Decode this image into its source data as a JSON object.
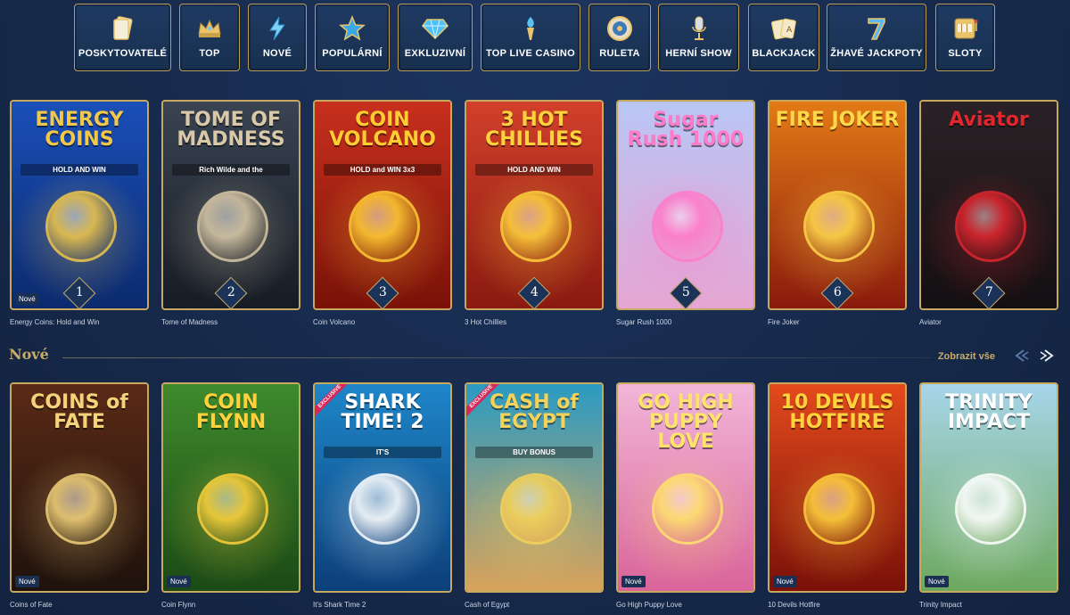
{
  "categories": [
    {
      "label": "POSKYTOVATELÉ",
      "icon": "cards-icon"
    },
    {
      "label": "TOP",
      "icon": "crown-icon"
    },
    {
      "label": "NOVÉ",
      "icon": "lightning-icon"
    },
    {
      "label": "POPULÁRNÍ",
      "icon": "star-icon"
    },
    {
      "label": "EXKLUZIVNÍ",
      "icon": "diamond-icon"
    },
    {
      "label": "TOP LIVE CASINO",
      "icon": "torch-icon"
    },
    {
      "label": "RULETA",
      "icon": "roulette-icon"
    },
    {
      "label": "HERNÍ SHOW",
      "icon": "microphone-icon"
    },
    {
      "label": "BLACKJACK",
      "icon": "playing-cards-icon"
    },
    {
      "label": "ŽHAVÉ JACKPOTY",
      "icon": "seven-icon"
    },
    {
      "label": "SLOTY",
      "icon": "slot-machine-icon"
    }
  ],
  "top_games": [
    {
      "name": "Energy Coins: Hold and Win",
      "art_title": "ENERGY COINS",
      "art_sub": "HOLD AND WIN",
      "rank": "1",
      "badge": "Nové",
      "bg1": "#1a4fb8",
      "bg2": "#0b2a6e",
      "accent": "#f2c84b"
    },
    {
      "name": "Tome of Madness",
      "art_title": "TOME OF MADNESS",
      "art_sub": "Rich Wilde and the",
      "rank": "2",
      "badge": "",
      "bg1": "#3a4452",
      "bg2": "#161c25",
      "accent": "#d9c9a8"
    },
    {
      "name": "Coin Volcano",
      "art_title": "COIN VOLCANO",
      "art_sub": "HOLD and WIN 3x3",
      "rank": "3",
      "badge": "",
      "bg1": "#c8301d",
      "bg2": "#7a1208",
      "accent": "#ffcc33"
    },
    {
      "name": "3 Hot Chillies",
      "art_title": "3 HOT CHILLIES",
      "art_sub": "HOLD AND WIN",
      "rank": "4",
      "badge": "",
      "bg1": "#d1402a",
      "bg2": "#8a1a10",
      "accent": "#ffd23d"
    },
    {
      "name": "Sugar Rush 1000",
      "art_title": "Sugar Rush 1000",
      "art_sub": "",
      "rank": "5",
      "badge": "",
      "bg1": "#b9c6f5",
      "bg2": "#e6a6d4",
      "accent": "#ff7ac8"
    },
    {
      "name": "Fire Joker",
      "art_title": "FIRE JOKER",
      "art_sub": "",
      "rank": "6",
      "badge": "",
      "bg1": "#e37a16",
      "bg2": "#8a1a0c",
      "accent": "#ffd84a"
    },
    {
      "name": "Aviator",
      "art_title": "Aviator",
      "art_sub": "",
      "rank": "7",
      "badge": "",
      "bg1": "#2a2226",
      "bg2": "#140f12",
      "accent": "#e0262f"
    }
  ],
  "new_section": {
    "title": "Nové",
    "show_all": "Zobrazit vše"
  },
  "new_games": [
    {
      "name": "Coins of Fate",
      "art_title": "COINS of FATE",
      "art_sub": "",
      "badge": "Nové",
      "exclusive": "",
      "bg1": "#5a2a16",
      "bg2": "#1e120c",
      "accent": "#f3d27a"
    },
    {
      "name": "Coin Flynn",
      "art_title": "COIN FLYNN",
      "art_sub": "",
      "badge": "Nové",
      "exclusive": "",
      "bg1": "#3f8a2c",
      "bg2": "#1b4a16",
      "accent": "#ffd23d"
    },
    {
      "name": "It's Shark Time 2",
      "art_title": "SHARK TIME! 2",
      "art_sub": "IT'S",
      "badge": "",
      "exclusive": "EXCLUSIVE",
      "bg1": "#1e86c9",
      "bg2": "#0c3f7a",
      "accent": "#ffffff"
    },
    {
      "name": "Cash of Egypt",
      "art_title": "CASH of EGYPT",
      "art_sub": "BUY BONUS",
      "badge": "",
      "exclusive": "EXCLUSIVE",
      "bg1": "#2a9bc2",
      "bg2": "#d9a35a",
      "accent": "#f5d35a"
    },
    {
      "name": "Go High Puppy Love",
      "art_title": "GO HIGH PUPPY LOVE",
      "art_sub": "",
      "badge": "Nové",
      "exclusive": "",
      "bg1": "#f2b6d8",
      "bg2": "#d9649a",
      "accent": "#ffe36b"
    },
    {
      "name": "10 Devils Hotfire",
      "art_title": "10 DEVILS HOTFIRE",
      "art_sub": "",
      "badge": "Nové",
      "exclusive": "",
      "bg1": "#e34a1c",
      "bg2": "#7a1008",
      "accent": "#ffd23d"
    },
    {
      "name": "Trinity Impact",
      "art_title": "TRINITY IMPACT",
      "art_sub": "",
      "badge": "Nové",
      "exclusive": "",
      "bg1": "#a7d6ea",
      "bg2": "#6da85e",
      "accent": "#ffffff"
    }
  ]
}
